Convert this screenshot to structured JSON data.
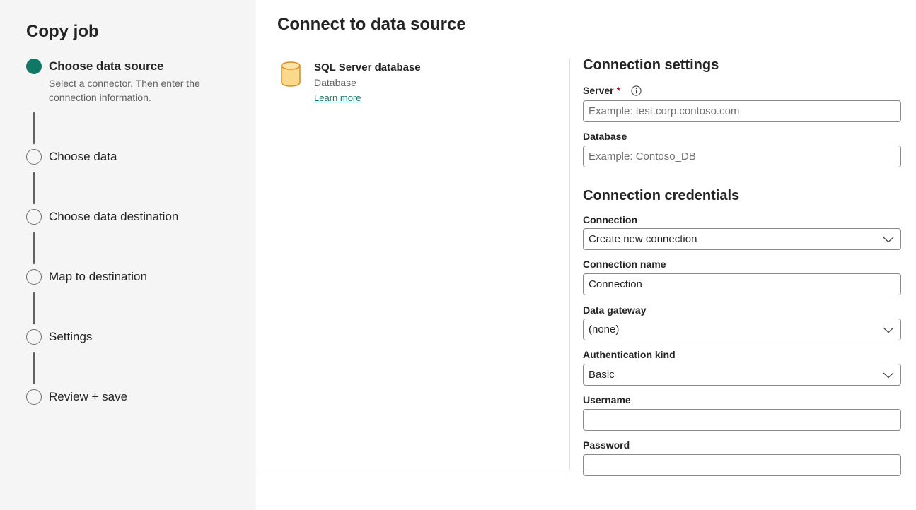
{
  "sidebar": {
    "title": "Copy job",
    "steps": [
      {
        "label": "Choose data source",
        "description": "Select a connector. Then enter the connection information.",
        "state": "active"
      },
      {
        "label": "Choose data",
        "state": "pending"
      },
      {
        "label": "Choose data destination",
        "state": "pending"
      },
      {
        "label": "Map to destination",
        "state": "pending"
      },
      {
        "label": "Settings",
        "state": "pending"
      },
      {
        "label": "Review + save",
        "state": "pending"
      }
    ]
  },
  "main": {
    "title": "Connect to data source",
    "connector": {
      "name": "SQL Server database",
      "category": "Database",
      "link": "Learn more",
      "icon": "database-cylinder-icon"
    }
  },
  "connection_settings": {
    "title": "Connection settings",
    "server": {
      "label": "Server",
      "required_mark": "*",
      "placeholder": "Example: test.corp.contoso.com",
      "value": ""
    },
    "database": {
      "label": "Database",
      "placeholder": "Example: Contoso_DB",
      "value": ""
    }
  },
  "connection_credentials": {
    "title": "Connection credentials",
    "connection": {
      "label": "Connection",
      "value": "Create new connection"
    },
    "connection_name": {
      "label": "Connection name",
      "value": "Connection"
    },
    "data_gateway": {
      "label": "Data gateway",
      "value": "(none)"
    },
    "auth_kind": {
      "label": "Authentication kind",
      "value": "Basic"
    },
    "username": {
      "label": "Username",
      "value": ""
    },
    "password": {
      "label": "Password",
      "value": ""
    }
  },
  "colors": {
    "accent": "#117865",
    "required": "#c50f1f",
    "connector_icon": "#f7c86a"
  }
}
